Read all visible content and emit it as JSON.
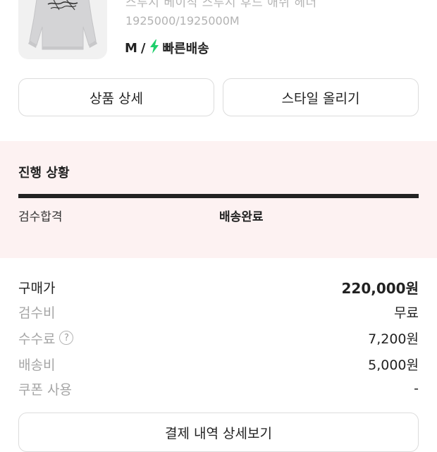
{
  "product": {
    "name": "스투시 베이직 스투시 후드 애쉬 헤더",
    "code": "1925000/1925000M",
    "size": "M",
    "separator": "/",
    "shipping": "빠른배송",
    "thumb_logo": "Stussy",
    "colors": {
      "bolt": "#1fcf6b",
      "thumb_bg": "#f1f1f1"
    }
  },
  "actions": {
    "detail_label": "상품 상세",
    "style_label": "스타일 올리기"
  },
  "progress": {
    "title": "진행 상황",
    "steps": [
      "검수합격",
      "배송완료"
    ],
    "colors": {
      "bg": "#fdf2f2",
      "bar": "#222222"
    }
  },
  "price": {
    "rows": [
      {
        "label": "구매가",
        "value": "220,000원"
      },
      {
        "label": "검수비",
        "value": "무료"
      },
      {
        "label": "수수료",
        "value": "7,200원",
        "help": "?"
      },
      {
        "label": "배송비",
        "value": "5,000원"
      },
      {
        "label": "쿠폰 사용",
        "value": "-"
      }
    ]
  },
  "payment": {
    "button_label": "결제 내역 상세보기"
  }
}
